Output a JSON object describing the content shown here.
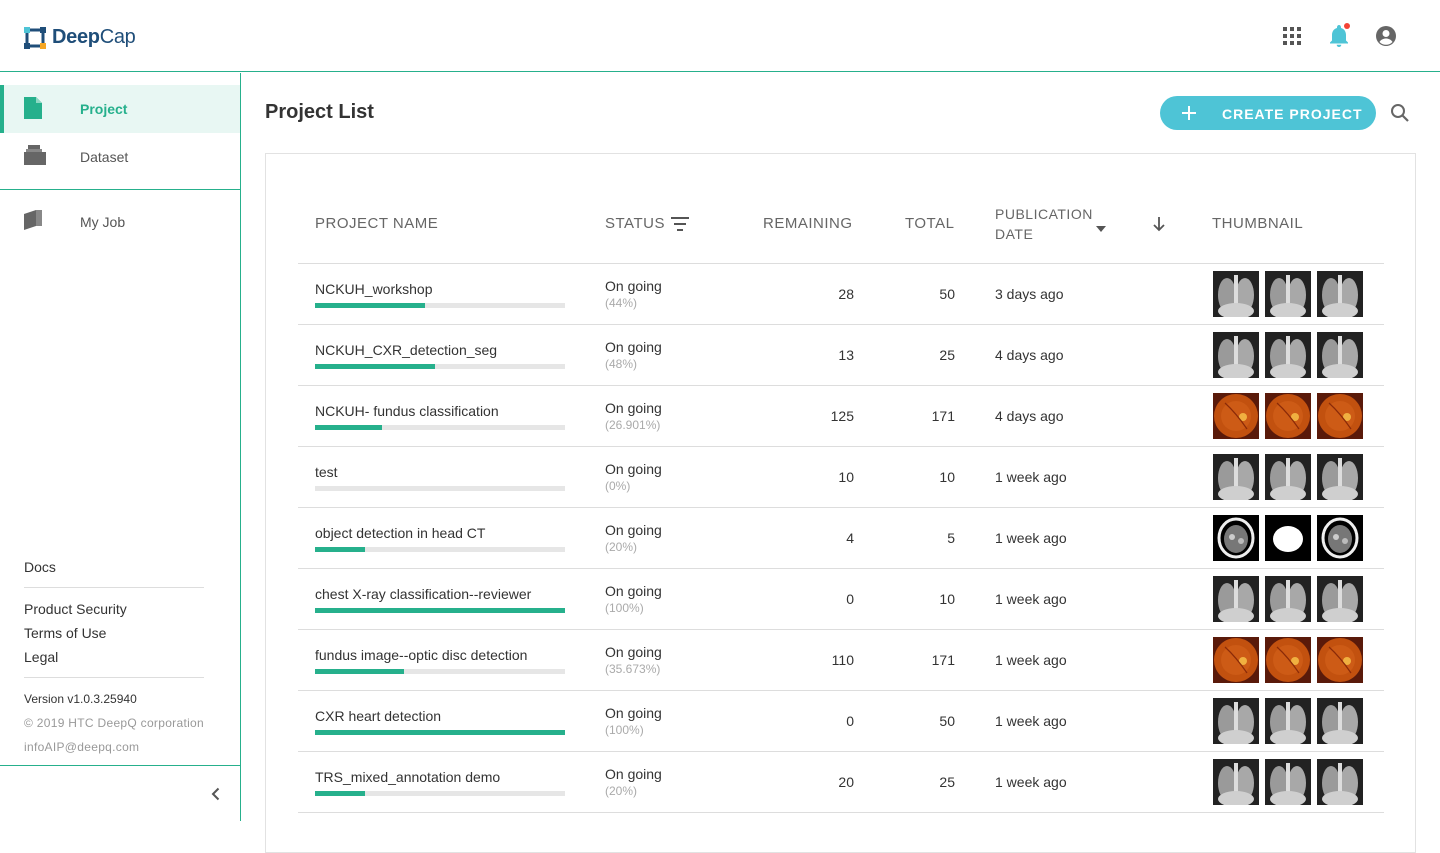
{
  "header": {
    "brand_bold": "Deep",
    "brand_light": "Cap",
    "icons": [
      "apps-grid-icon",
      "bell-icon",
      "account-icon"
    ],
    "accent_color": "#26b08c",
    "notification_dot_color": "#f44336"
  },
  "sidebar": {
    "items": [
      {
        "label": "Project",
        "icon": "file-icon",
        "active": true
      },
      {
        "label": "Dataset",
        "icon": "folder-stack-icon",
        "active": false
      },
      {
        "label": "My Job",
        "icon": "book-icon",
        "active": false
      }
    ],
    "footer": {
      "docs": "Docs",
      "product_security": "Product Security",
      "terms": "Terms of Use",
      "legal": "Legal",
      "version": "Version v1.0.3.25940",
      "copyright": "© 2019 HTC DeepQ corporation",
      "email": "infoAIP@deepq.com"
    }
  },
  "main": {
    "title": "Project List",
    "create_button": "CREATE PROJECT",
    "button_color": "#4ec4d6",
    "columns": {
      "name": "PROJECT NAME",
      "status": "STATUS",
      "remaining": "REMAINING",
      "total": "TOTAL",
      "pub_line1": "PUBLICATION",
      "pub_line2": "DATE",
      "thumbnail": "THUMBNAIL"
    },
    "rows": [
      {
        "name": "NCKUH_workshop",
        "progress": 0.44,
        "status": "On going",
        "pct": "(44%)",
        "remaining": "28",
        "total": "50",
        "date": "3 days ago",
        "thumbs": [
          "xray",
          "xray",
          "xray"
        ]
      },
      {
        "name": "NCKUH_CXR_detection_seg",
        "progress": 0.48,
        "status": "On going",
        "pct": "(48%)",
        "remaining": "13",
        "total": "25",
        "date": "4 days ago",
        "thumbs": [
          "xray",
          "xray",
          "xray"
        ]
      },
      {
        "name": "NCKUH- fundus classification",
        "progress": 0.26901,
        "status": "On going",
        "pct": "(26.901%)",
        "remaining": "125",
        "total": "171",
        "date": "4 days ago",
        "thumbs": [
          "fundus",
          "fundus",
          "fundus"
        ]
      },
      {
        "name": "test",
        "progress": 0,
        "status": "On going",
        "pct": "(0%)",
        "remaining": "10",
        "total": "10",
        "date": "1 week ago",
        "thumbs": [
          "xray",
          "xray",
          "xray"
        ]
      },
      {
        "name": "object detection in head CT",
        "progress": 0.2,
        "status": "On going",
        "pct": "(20%)",
        "remaining": "4",
        "total": "5",
        "date": "1 week ago",
        "thumbs": [
          "ct",
          "ctwhite",
          "ct"
        ]
      },
      {
        "name": "chest X-ray classification--reviewer",
        "progress": 1.0,
        "status": "On going",
        "pct": "(100%)",
        "remaining": "0",
        "total": "10",
        "date": "1 week ago",
        "thumbs": [
          "xray",
          "xray",
          "xray"
        ]
      },
      {
        "name": "fundus image--optic disc detection",
        "progress": 0.35673,
        "status": "On going",
        "pct": "(35.673%)",
        "remaining": "110",
        "total": "171",
        "date": "1 week ago",
        "thumbs": [
          "fundus",
          "fundus",
          "fundus"
        ]
      },
      {
        "name": "CXR heart detection",
        "progress": 1.0,
        "status": "On going",
        "pct": "(100%)",
        "remaining": "0",
        "total": "50",
        "date": "1 week ago",
        "thumbs": [
          "xray",
          "xray",
          "xray"
        ]
      },
      {
        "name": "TRS_mixed_annotation demo",
        "progress": 0.2,
        "status": "On going",
        "pct": "(20%)",
        "remaining": "20",
        "total": "25",
        "date": "1 week ago",
        "thumbs": [
          "xray",
          "xray",
          "xray"
        ]
      }
    ]
  }
}
